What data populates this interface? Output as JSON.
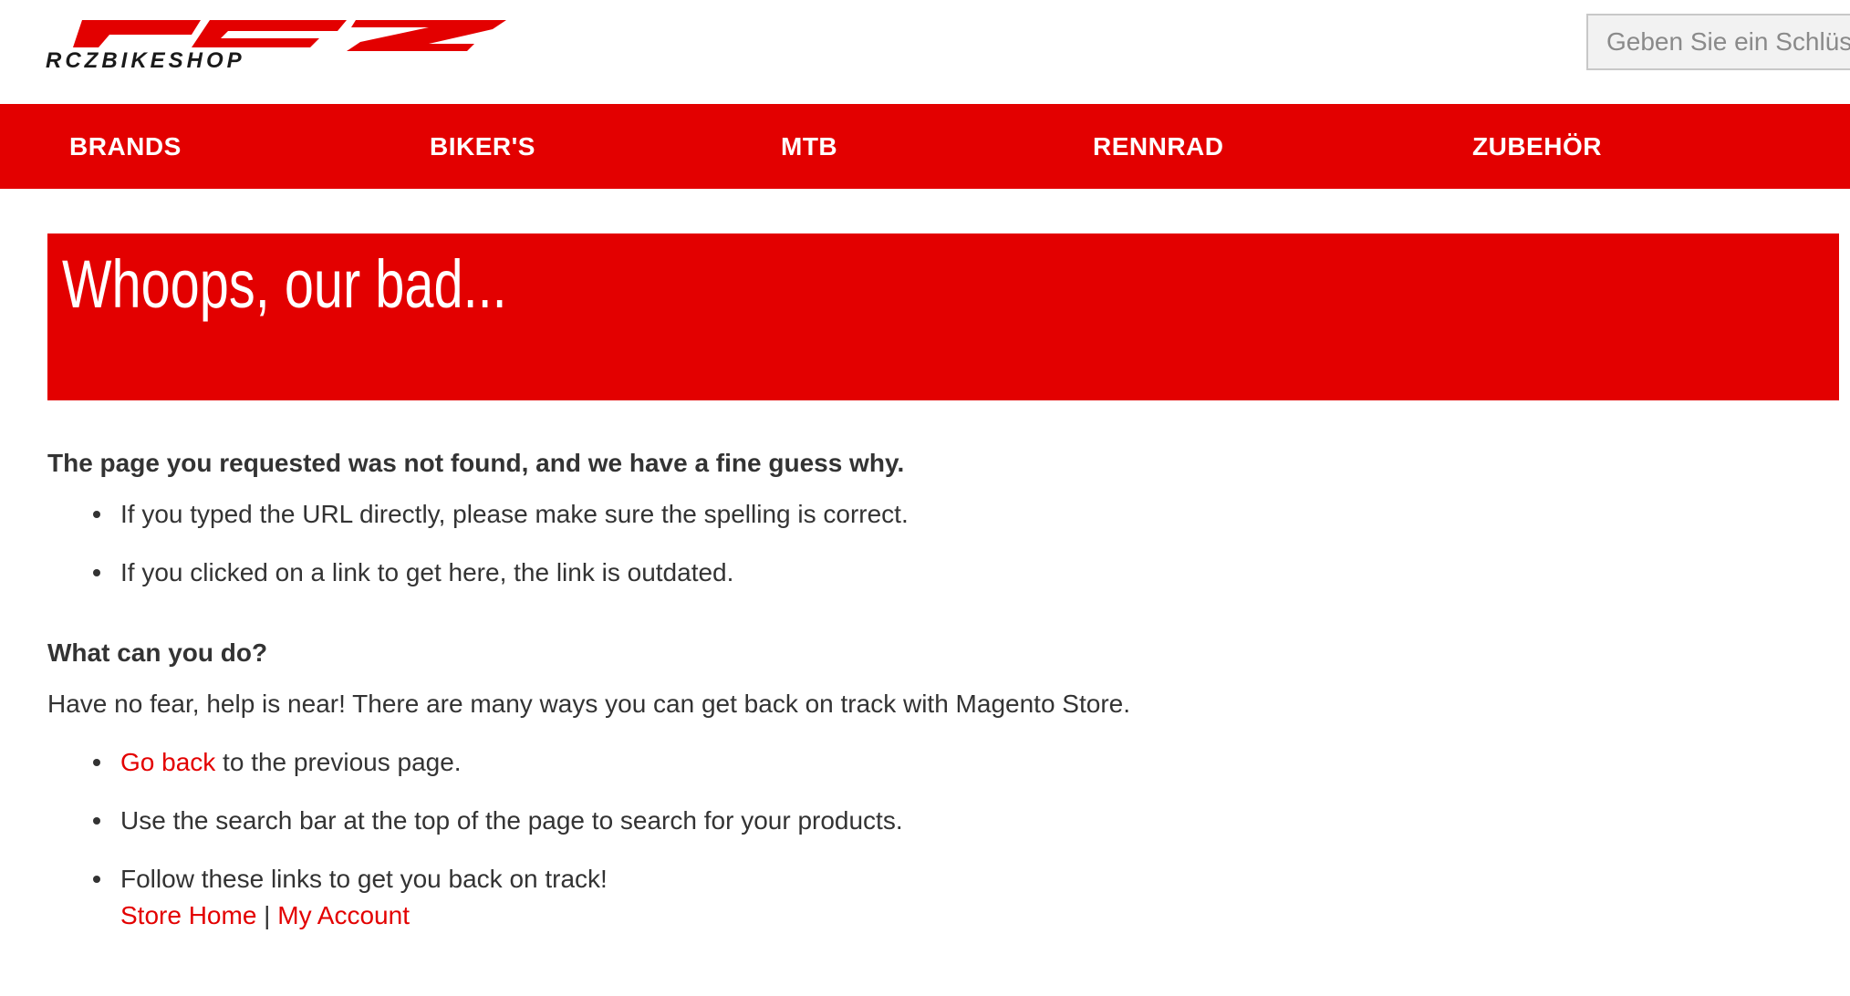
{
  "brand": {
    "logo_text": "RCZ",
    "logo_subtext": "RCZBIKESHOP",
    "accent_color": "#e30000"
  },
  "search": {
    "placeholder": "Geben Sie ein Schlüsselwort ein"
  },
  "nav": {
    "items": [
      {
        "label": "BRANDS"
      },
      {
        "label": "BIKER'S"
      },
      {
        "label": "MTB"
      },
      {
        "label": "RENNRAD"
      },
      {
        "label": "ZUBEHÖR"
      }
    ]
  },
  "hero": {
    "title": "Whoops, our bad..."
  },
  "content": {
    "heading1": "The page you requested was not found, and we have a fine guess why.",
    "reasons": [
      "If you typed the URL directly, please make sure the spelling is correct.",
      "If you clicked on a link to get here, the link is outdated."
    ],
    "heading2": "What can you do?",
    "intro": "Have no fear, help is near! There are many ways you can get back on track with Magento Store.",
    "go_back_link": "Go back",
    "go_back_rest": " to the previous page.",
    "search_tip": "Use the search bar at the top of the page to search for your products.",
    "follow_links": "Follow these links to get you back on track!",
    "store_home_link": "Store Home",
    "separator": " | ",
    "my_account_link": "My Account"
  }
}
